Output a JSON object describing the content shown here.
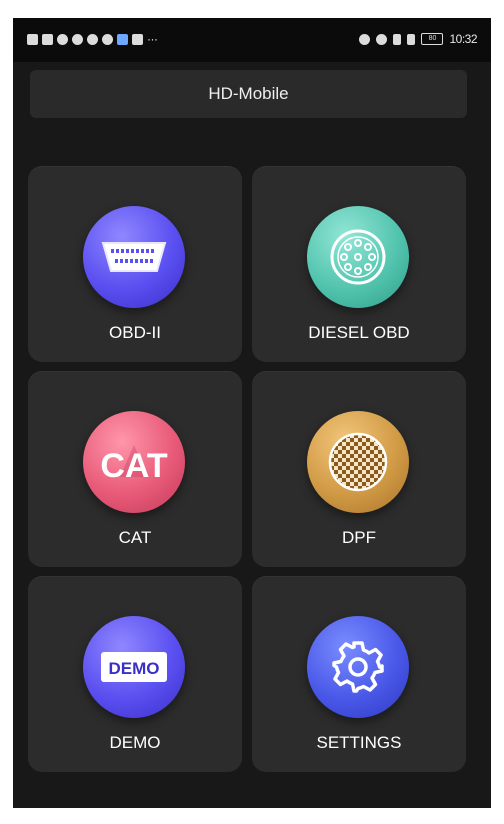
{
  "status_bar": {
    "time": "10:32",
    "battery": "80"
  },
  "app_bar": {
    "title": "HD-Mobile"
  },
  "menu": [
    {
      "label": "OBD-II",
      "icon": "obd-connector-icon",
      "color": "#5a4ff0"
    },
    {
      "label": "DIESEL OBD",
      "icon": "round-connector-icon",
      "color": "#52c4ae"
    },
    {
      "label": "CAT",
      "icon": "cat-logo-icon",
      "color": "#e85a78"
    },
    {
      "label": "DPF",
      "icon": "dpf-filter-icon",
      "color": "#d19a45"
    },
    {
      "label": "DEMO",
      "icon": "demo-badge-icon",
      "color": "#5a4ff0"
    },
    {
      "label": "SETTINGS",
      "icon": "gear-icon",
      "color": "#4a58e8"
    }
  ]
}
